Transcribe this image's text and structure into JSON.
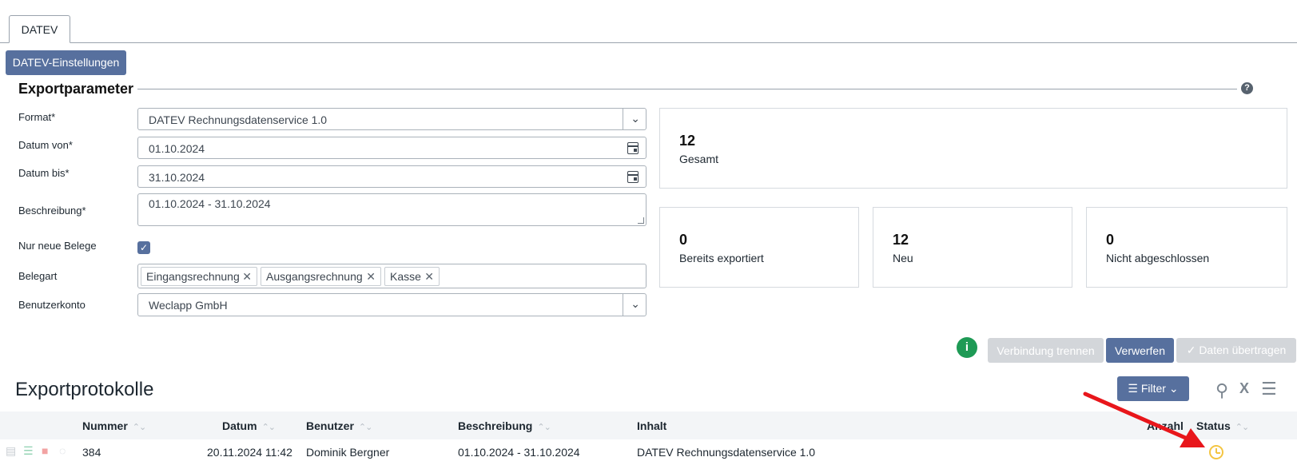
{
  "tabs": [
    {
      "label": "DATEV"
    }
  ],
  "toolbar": {
    "settings_label": "DATEV-Einstellungen"
  },
  "section": {
    "title": "Exportparameter",
    "help": "?"
  },
  "form": {
    "format": {
      "label": "Format*",
      "value": "DATEV Rechnungsdatenservice 1.0"
    },
    "date_from": {
      "label": "Datum von*",
      "value": "01.10.2024"
    },
    "date_to": {
      "label": "Datum bis*",
      "value": "31.10.2024"
    },
    "description": {
      "label": "Beschreibung*",
      "value": "01.10.2024 - 31.10.2024"
    },
    "only_new": {
      "label": "Nur neue Belege",
      "checked": true
    },
    "doc_type": {
      "label": "Belegart",
      "chips": [
        "Eingangsrechnung",
        "Ausgangsrechnung",
        "Kasse"
      ]
    },
    "account": {
      "label": "Benutzerkonto",
      "value": "Weclapp GmbH"
    }
  },
  "stats": {
    "total": {
      "value": "12",
      "label": "Gesamt"
    },
    "exported": {
      "value": "0",
      "label": "Bereits exportiert"
    },
    "new": {
      "value": "12",
      "label": "Neu"
    },
    "not_closed": {
      "value": "0",
      "label": "Nicht abgeschlossen"
    }
  },
  "actions": {
    "info": "i",
    "disconnect": "Verbindung trennen",
    "discard": "Verwerfen",
    "transfer": "✓ Daten übertragen"
  },
  "log": {
    "title": "Exportprotokolle",
    "filter_label": "Filter",
    "columns": [
      "Nummer",
      "Datum",
      "Benutzer",
      "Beschreibung",
      "Inhalt",
      "Anzahl",
      "Status"
    ],
    "rows": [
      {
        "number": "384",
        "date": "20.11.2024 11:42",
        "user": "Dominik Bergner",
        "description": "01.10.2024 - 31.10.2024",
        "content": "DATEV Rechnungsdatenservice 1.0",
        "count": "",
        "status": "pending"
      }
    ]
  },
  "colors": {
    "primary": "#57709e",
    "success": "#1e9a55",
    "pending": "#f4c542",
    "annotation_arrow": "#e8161b"
  }
}
